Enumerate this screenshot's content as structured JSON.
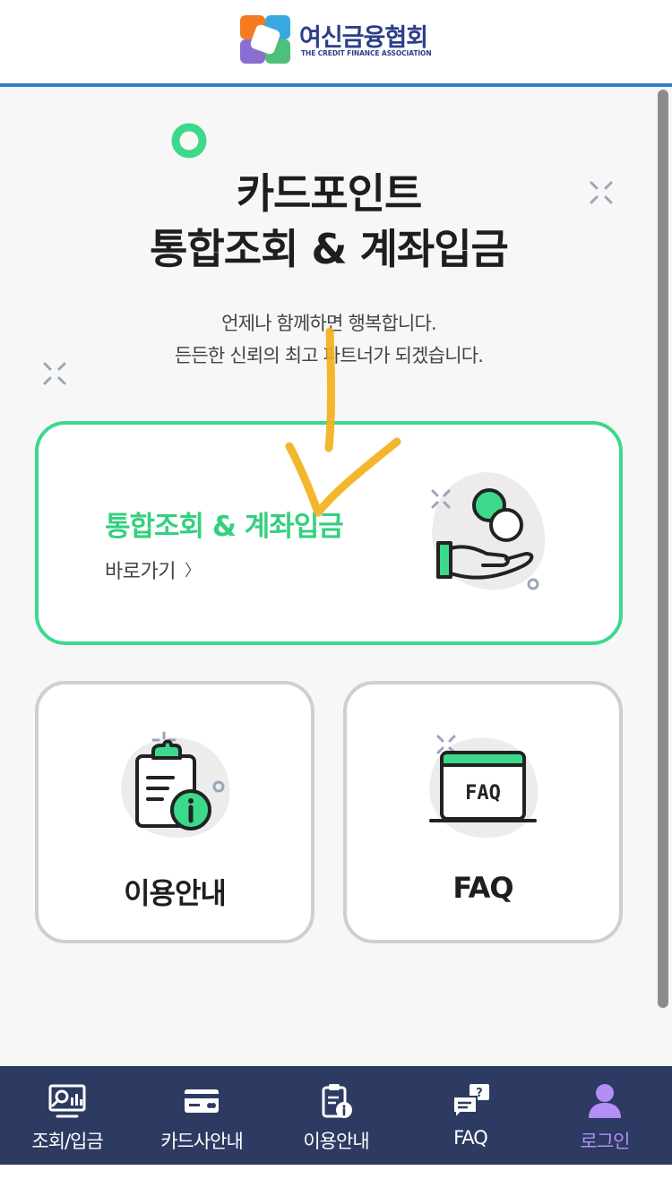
{
  "header": {
    "logo_name": "여신금융협회",
    "logo_english": "THE CREDIT FINANCE ASSOCIATION"
  },
  "hero": {
    "title_line1": "카드포인트",
    "title_line2": "통합조회 & 계좌입금",
    "subtitle_line1": "언제나 함께하면 행복합니다.",
    "subtitle_line2": "든든한 신뢰의 최고 파트너가 되겠습니다."
  },
  "main_card": {
    "title": "통합조회 & 계좌입금",
    "link_label": "바로가기",
    "link_chevron": "〉",
    "icon": "hand-coins-icon"
  },
  "small_cards": [
    {
      "label": "이용안내",
      "icon": "clipboard-info-icon"
    },
    {
      "label": "FAQ",
      "icon": "faq-window-icon",
      "icon_text": "FAQ"
    }
  ],
  "bottom_nav": [
    {
      "label": "조회/입금",
      "icon": "search-chart-icon",
      "active": false
    },
    {
      "label": "카드사안내",
      "icon": "credit-card-icon",
      "active": false
    },
    {
      "label": "이용안내",
      "icon": "clipboard-info-icon",
      "active": false
    },
    {
      "label": "FAQ",
      "icon": "chat-question-icon",
      "active": false
    },
    {
      "label": "로그인",
      "icon": "user-icon",
      "active": true
    }
  ],
  "colors": {
    "accent_green": "#3cd98a",
    "nav_background": "#2d3a62",
    "nav_active": "#b38ef5",
    "header_line": "#2f7fc7",
    "annotation_arrow": "#f2b11c"
  }
}
